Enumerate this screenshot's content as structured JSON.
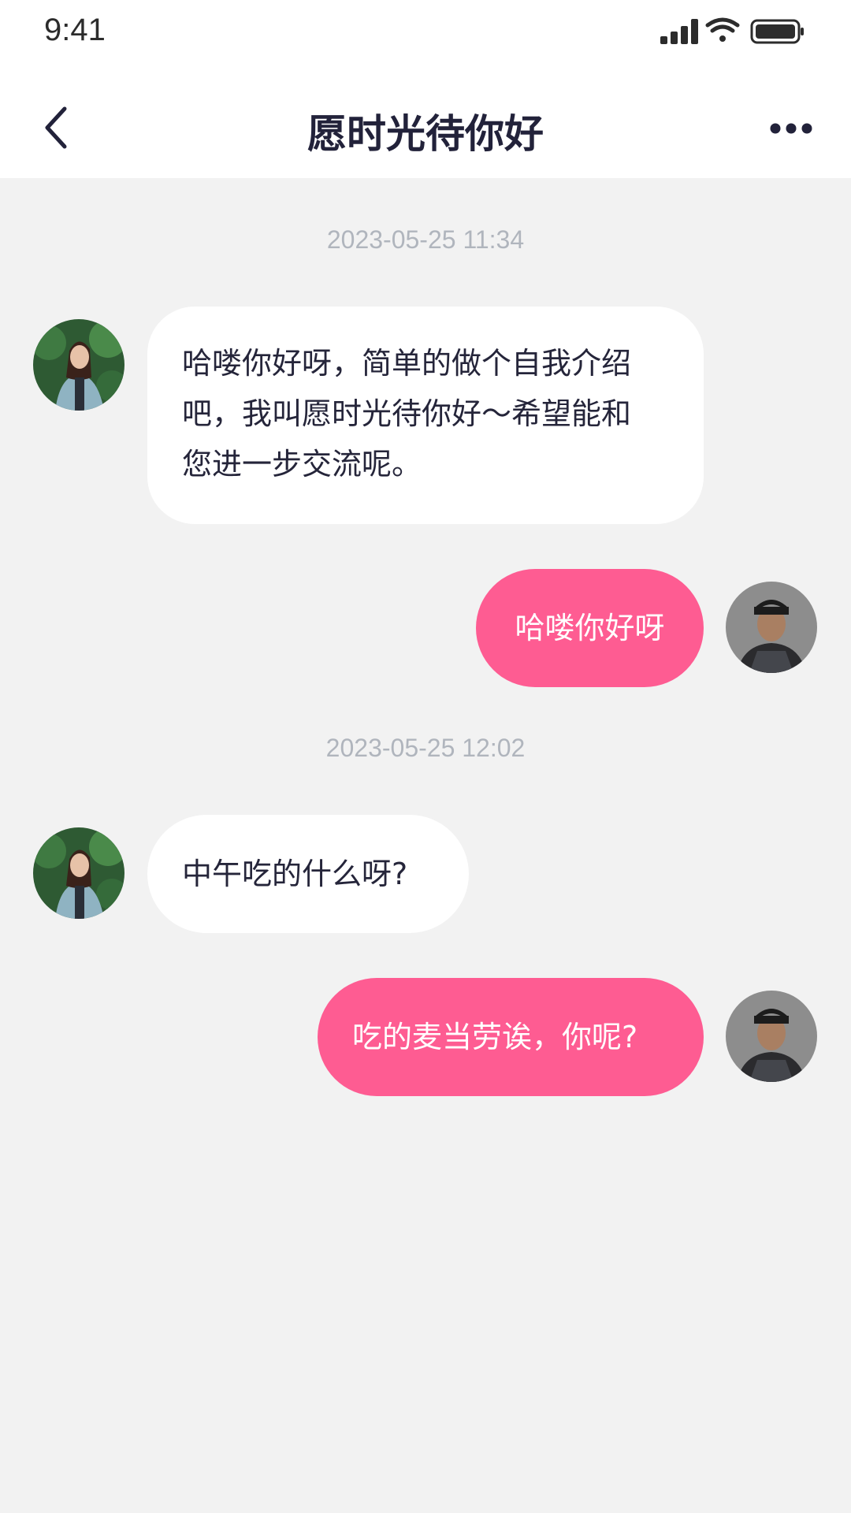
{
  "status_bar": {
    "time": "9:41",
    "icons": [
      "signal-icon",
      "wifi-icon",
      "battery-icon"
    ]
  },
  "nav": {
    "title": "愿时光待你好",
    "back_icon": "chevron-left-icon",
    "more_icon": "more-dots-icon"
  },
  "theme": {
    "accent": "#fe5c92",
    "background": "#f2f2f2",
    "incoming_bubble": "#ffffff",
    "timestamp_color": "#b0b5bd"
  },
  "chat": {
    "timestamps": [
      "2023-05-25 11:34",
      "2023-05-25 12:02"
    ],
    "messages": [
      {
        "sender": "other",
        "lines": [
          "哈喽你好呀，简单的做个自我介绍",
          "吧，我叫愿时光待你好～希望能和",
          "您进一步交流呢。"
        ]
      },
      {
        "sender": "me",
        "text": "哈喽你好呀"
      },
      {
        "sender": "other",
        "text": "中午吃的什么呀?"
      },
      {
        "sender": "me",
        "text": "吃的麦当劳诶，你呢?"
      }
    ]
  }
}
